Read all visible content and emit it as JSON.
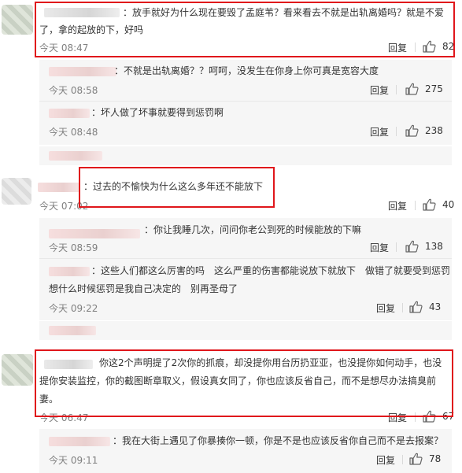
{
  "comments": [
    {
      "text_line1": "：放手就好为什么现在要毁了孟庭苇？看来看去不就是出轨离婚吗？就是不爱",
      "text_line2": "了，拿的起放的下，好吗",
      "time": "今天 08:47",
      "reply": "回复",
      "likes": "82",
      "replies": [
        {
          "text": "：不就是出轨离婚？？呵呵，没发生在你身上你可真是宽容大度",
          "time": "今天 08:58",
          "reply": "回复",
          "likes": "275"
        },
        {
          "text": "：坏人做了坏事就要得到惩罚啊",
          "time": "今天 08:48",
          "reply": "回复",
          "likes": "238"
        }
      ]
    },
    {
      "text": "：过去的不愉快为什么这么多年还不能放下",
      "time": "今天 07:02",
      "reply": "回复",
      "likes": "40",
      "replies": [
        {
          "text": "：你让我睡几次，问问你老公到死的时候能放的下嘛",
          "time": "今天 08:59",
          "reply": "回复",
          "likes": "138"
        },
        {
          "text_line1": "：这些人们都这么厉害的吗　这么严重的伤害都能说放下就放下　做错了就要受到惩罚",
          "text_line2": "想什么时候惩罚是我自己决定的　别再圣母了",
          "time": "今天 09:22",
          "reply": "回复",
          "likes": "43"
        }
      ]
    },
    {
      "text_line1": "你这2个声明提了2次你的抓痕，却没提你用台历扔亚亚，也没提你如何动手，也没",
      "text_line2": "提你安装监控，你的截图断章取义，假设真女同了，你也应该反省自己，而不是想尽办法搞臭前",
      "text_line3": "妻。",
      "time": "今天 06:47",
      "reply": "回复",
      "likes": "67",
      "replies": [
        {
          "text": "：我在大街上遇见了你暴揍你一顿，你是不是也应该反省你自己而不是去报案？",
          "time": "今天 09:11",
          "reply": "回复",
          "likes": "78"
        }
      ]
    }
  ],
  "icons": {
    "like": "thumbs-up-icon"
  },
  "colors": {
    "highlight_box": "#e0161b",
    "sub_panel": "#f6f6f6",
    "time": "#808080"
  }
}
